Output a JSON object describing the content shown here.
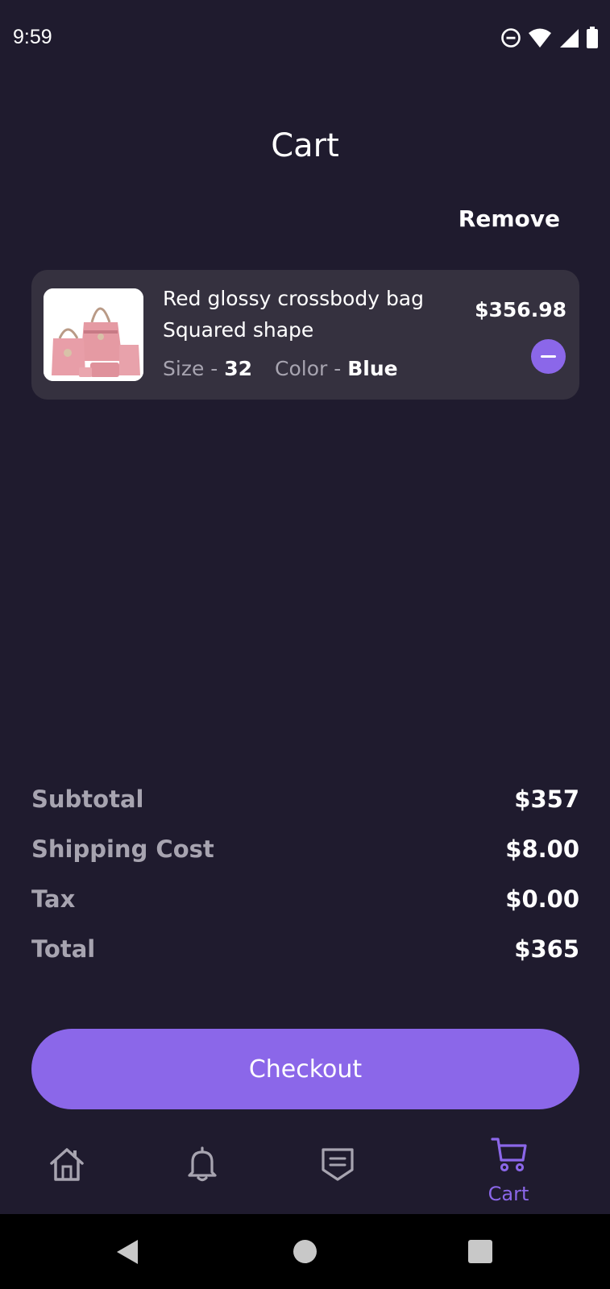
{
  "status_bar": {
    "time": "9:59",
    "icons": [
      "do-not-disturb-icon",
      "wifi-icon",
      "signal-icon",
      "battery-icon"
    ]
  },
  "header": {
    "title": "Cart",
    "remove_label": "Remove"
  },
  "cart_items": [
    {
      "name": "Red glossy crossbody bag Squared shape",
      "size_label": "Size - ",
      "size_value": "32",
      "color_label": "Color - ",
      "color_value": "Blue",
      "price": "$356.98"
    }
  ],
  "summary": {
    "subtotal_label": "Subtotal",
    "subtotal_value": "$357",
    "shipping_label": "Shipping Cost",
    "shipping_value": "$8.00",
    "tax_label": "Tax",
    "tax_value": "$0.00",
    "total_label": "Total",
    "total_value": "$365"
  },
  "checkout_label": "Checkout",
  "bottom_nav": {
    "items": [
      "home-icon",
      "bell-icon",
      "orders-icon",
      "cart-icon"
    ],
    "active_label": "Cart"
  },
  "colors": {
    "background": "#1f1b2e",
    "card": "#35313f",
    "accent": "#8b67e9",
    "muted_text": "#a7a4b0"
  }
}
